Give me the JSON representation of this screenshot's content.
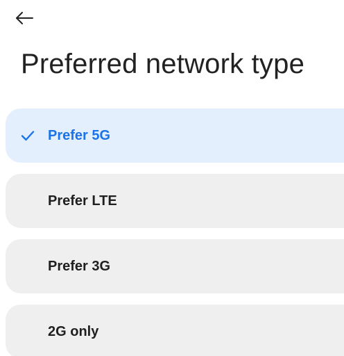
{
  "header": {
    "back_icon": "arrow-left-icon",
    "title": "Preferred network type"
  },
  "options": [
    {
      "label": "Prefer 5G",
      "selected": true
    },
    {
      "label": "Prefer LTE",
      "selected": false
    },
    {
      "label": "Prefer 3G",
      "selected": false
    },
    {
      "label": "2G only",
      "selected": false
    }
  ],
  "selected_icon": "checkmark-icon",
  "colors": {
    "accent": "#1a73e8",
    "selected_background": "#e3effd",
    "option_background": "#efefef"
  }
}
